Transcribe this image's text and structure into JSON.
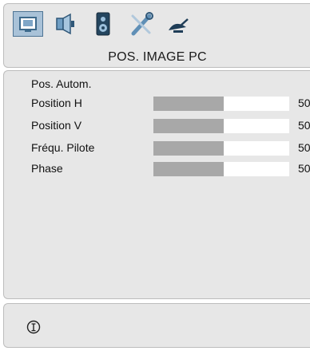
{
  "menu": {
    "tabs": [
      {
        "icon": "picture-icon",
        "selected": true
      },
      {
        "icon": "audio-icon",
        "selected": false
      },
      {
        "icon": "speaker-icon",
        "selected": false
      },
      {
        "icon": "tools-icon",
        "selected": false
      },
      {
        "icon": "satellite-icon",
        "selected": false
      }
    ],
    "title": "POS. IMAGE PC"
  },
  "items": [
    {
      "label": "Pos. Autom."
    },
    {
      "label": "Position H",
      "value": "50",
      "level": 0.52
    },
    {
      "label": "Position V",
      "value": "50",
      "level": 0.52
    },
    {
      "label": "Fréqu. Pilote",
      "value": "50",
      "level": 0.52
    },
    {
      "label": "Phase",
      "value": "50",
      "level": 0.52
    }
  ],
  "footer": {
    "icon": "info-icon"
  },
  "colors": {
    "panel": "#e7e7e7",
    "bar_fill": "#a8a8a8",
    "bar_empty": "#ffffff",
    "tab_selected": "#a9c2d8"
  }
}
